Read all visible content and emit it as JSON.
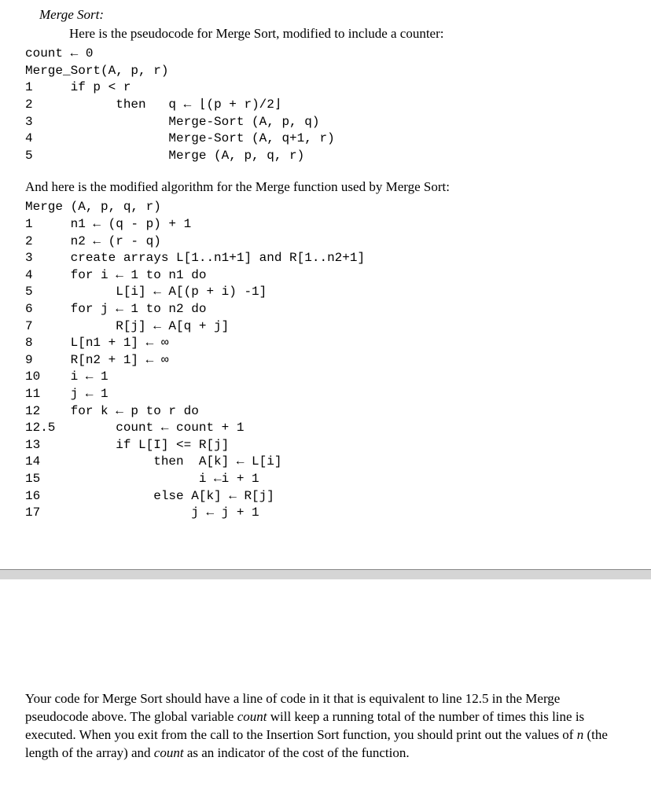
{
  "title": "Merge Sort:",
  "intro": "Here is the pseudocode for Merge Sort, modified to include a counter:",
  "code1": "count ← 0\nMerge_Sort(A, p, r)\n1     if p < r\n2           then   q ← ⌊(p + r)/2⌋\n3                  Merge-Sort (A, p, q)\n4                  Merge-Sort (A, q+1, r)\n5                  Merge (A, p, q, r)",
  "narrative1": "And here is the modified algorithm for the Merge function used by Merge Sort:",
  "code2": "Merge (A, p, q, r)\n1     n1 ← (q - p) + 1\n2     n2 ← (r - q)\n3     create arrays L[1..n1+1] and R[1..n2+1]\n4     for i ← 1 to n1 do\n5           L[i] ← A[(p + i) -1]\n6     for j ← 1 to n2 do\n7           R[j] ← A[q + j]\n8     L[n1 + 1] ← ∞\n9     R[n2 + 1] ← ∞\n10    i ← 1\n11    j ← 1\n12    for k ← p to r do\n12.5        count ← count + 1\n13          if L[I] <= R[j]\n14               then  A[k] ← L[i]\n15                     i ←i + 1\n16               else A[k] ← R[j]\n17                    j ← j + 1",
  "footer": {
    "p1a": "Your code for Merge Sort should have a line of code in it that is equivalent to line 12.5 in the Merge pseudocode above.  The global variable ",
    "p1b": "count",
    "p1c": " will keep a running total of the number of times this line is executed.  When you exit from the call to the Insertion Sort function, you should print out the values of ",
    "p1d": "n",
    "p1e": " (the length of the array) and ",
    "p1f": "count",
    "p1g": " as an indicator of the cost of the function."
  }
}
